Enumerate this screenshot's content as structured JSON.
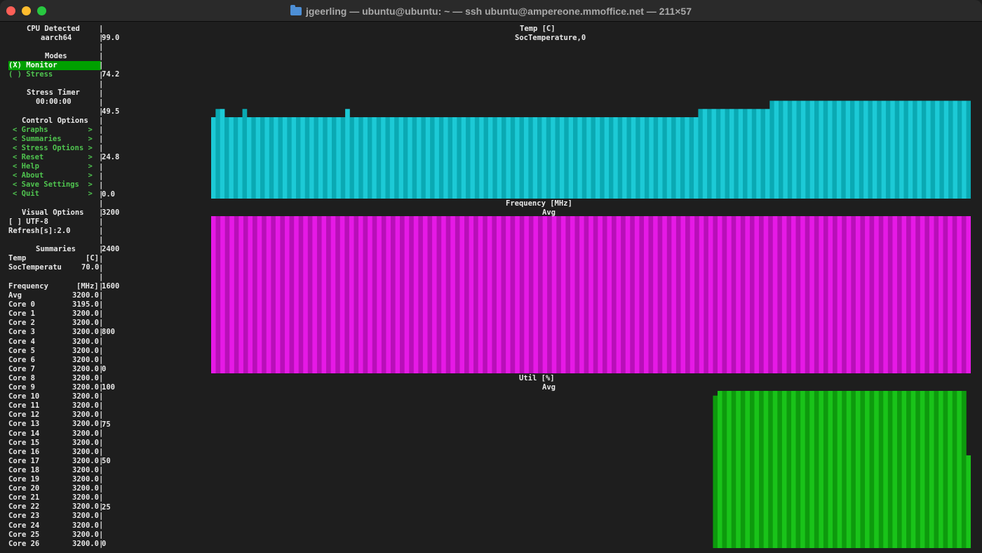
{
  "window": {
    "title": "jgeerling — ubuntu@ubuntu: ~ — ssh ubuntu@ampereone.mmoffice.net — 211×57"
  },
  "sidebar": {
    "cpu_header": "CPU Detected",
    "cpu_value": "aarch64",
    "modes_header": "Modes",
    "modes": [
      {
        "label": "(X) Monitor",
        "selected": true
      },
      {
        "label": "( ) Stress",
        "selected": false
      }
    ],
    "stress_timer_header": "Stress Timer",
    "stress_timer_value": "00:00:00",
    "control_header": "Control Options",
    "control_items": [
      "< Graphs         >",
      "< Summaries      >",
      "< Stress Options >",
      "< Reset          >",
      "< Help           >",
      "< About          >",
      "< Save Settings  >",
      "< Quit           >"
    ],
    "visual_header": "Visual Options",
    "utf8_option": "[ ] UTF-8",
    "refresh_option": "Refresh[s]:2.0",
    "summaries_header": "Summaries",
    "temp_row": {
      "label": "Temp",
      "unit": "[C]"
    },
    "soc_row": {
      "label": "SocTemperatu",
      "value": "70.0"
    },
    "freq_row": {
      "label": "Frequency",
      "unit": "[MHz]"
    },
    "freq_values": [
      {
        "label": "Avg",
        "value": "3200.0"
      },
      {
        "label": "Core 0",
        "value": "3195.0"
      },
      {
        "label": "Core 1",
        "value": "3200.0"
      },
      {
        "label": "Core 2",
        "value": "3200.0"
      },
      {
        "label": "Core 3",
        "value": "3200.0"
      },
      {
        "label": "Core 4",
        "value": "3200.0"
      },
      {
        "label": "Core 5",
        "value": "3200.0"
      },
      {
        "label": "Core 6",
        "value": "3200.0"
      },
      {
        "label": "Core 7",
        "value": "3200.0"
      },
      {
        "label": "Core 8",
        "value": "3200.0"
      },
      {
        "label": "Core 9",
        "value": "3200.0"
      },
      {
        "label": "Core 10",
        "value": "3200.0"
      },
      {
        "label": "Core 11",
        "value": "3200.0"
      },
      {
        "label": "Core 12",
        "value": "3200.0"
      },
      {
        "label": "Core 13",
        "value": "3200.0"
      },
      {
        "label": "Core 14",
        "value": "3200.0"
      },
      {
        "label": "Core 15",
        "value": "3200.0"
      },
      {
        "label": "Core 16",
        "value": "3200.0"
      },
      {
        "label": "Core 17",
        "value": "3200.0"
      },
      {
        "label": "Core 18",
        "value": "3200.0"
      },
      {
        "label": "Core 19",
        "value": "3200.0"
      },
      {
        "label": "Core 20",
        "value": "3200.0"
      },
      {
        "label": "Core 21",
        "value": "3200.0"
      },
      {
        "label": "Core 22",
        "value": "3200.0"
      },
      {
        "label": "Core 23",
        "value": "3200.0"
      },
      {
        "label": "Core 24",
        "value": "3200.0"
      },
      {
        "label": "Core 25",
        "value": "3200.0"
      },
      {
        "label": "Core 26",
        "value": "3200.0"
      }
    ]
  },
  "colors": {
    "temp": "#1ccad6",
    "temp_alt": "#0aa9b3",
    "freq": "#e619e6",
    "freq_alt": "#b80fb8",
    "util": "#19c319",
    "util_alt": "#0d9a0d"
  },
  "chart_data": [
    {
      "type": "bar",
      "title": "Temp [C]",
      "subtitle": "SocTemperature,0",
      "yticks": [
        "99.0",
        "74.2",
        "49.5",
        "24.8",
        "0.0"
      ],
      "ylim": [
        0,
        99.0
      ],
      "bar_values": [
        49.5,
        54.5,
        54.5,
        49.5,
        49.5,
        49.5,
        49.5,
        54.5,
        49.5,
        49.5,
        49.5,
        49.5,
        49.5,
        49.5,
        49.5,
        49.5,
        49.5,
        49.5,
        49.5,
        49.5,
        49.5,
        49.5,
        49.5,
        49.5,
        49.5,
        49.5,
        49.5,
        49.5,
        49.5,
        49.5,
        54.5,
        49.5,
        49.5,
        49.5,
        49.5,
        49.5,
        49.5,
        49.5,
        49.5,
        49.5,
        49.5,
        49.5,
        49.5,
        49.5,
        49.5,
        49.5,
        49.5,
        49.5,
        49.5,
        49.5,
        49.5,
        49.5,
        49.5,
        49.5,
        49.5,
        49.5,
        49.5,
        49.5,
        49.5,
        49.5,
        49.5,
        49.5,
        49.5,
        49.5,
        49.5,
        49.5,
        49.5,
        49.5,
        49.5,
        49.5,
        49.5,
        49.5,
        49.5,
        49.5,
        49.5,
        49.5,
        49.5,
        49.5,
        49.5,
        49.5,
        49.5,
        49.5,
        49.5,
        49.5,
        49.5,
        49.5,
        49.5,
        49.5,
        49.5,
        49.5,
        49.5,
        49.5,
        49.5,
        49.5,
        49.5,
        49.5,
        49.5,
        49.5,
        49.5,
        49.5,
        49.5,
        49.5,
        49.5,
        49.5,
        49.5,
        49.5,
        49.5,
        49.5,
        49.5,
        54.5,
        54.5,
        54.5,
        54.5,
        54.5,
        54.5,
        54.5,
        54.5,
        54.5,
        54.5,
        54.5,
        54.5,
        54.5,
        54.5,
        54.5,
        54.5,
        59.5,
        59.5,
        59.5,
        59.5,
        59.5,
        59.5,
        59.5,
        59.5,
        59.5,
        59.5,
        59.5,
        59.5,
        59.5,
        59.5,
        59.5,
        59.5,
        59.5,
        59.5,
        59.5,
        59.5,
        59.5,
        59.5,
        59.5,
        59.5,
        59.5,
        59.5,
        59.5,
        59.5,
        59.5,
        59.5,
        59.5,
        59.5,
        59.5,
        59.5,
        59.5,
        59.5,
        59.5,
        59.5,
        59.5,
        59.5,
        59.5,
        59.5,
        59.5,
        59.5,
        59.5
      ]
    },
    {
      "type": "bar",
      "title": "Frequency [MHz]",
      "subtitle": "Avg",
      "yticks": [
        "3200",
        "2400",
        "1600",
        "800",
        "0"
      ],
      "ylim": [
        0,
        3200
      ],
      "bar_values": [
        3200,
        3200,
        3200,
        3200,
        3200,
        3200,
        3200,
        3200,
        3200,
        3200,
        3200,
        3200,
        3200,
        3200,
        3200,
        3200,
        3200,
        3200,
        3200,
        3200,
        3200,
        3200,
        3200,
        3200,
        3200,
        3200,
        3200,
        3200,
        3200,
        3200,
        3200,
        3200,
        3200,
        3200,
        3200,
        3200,
        3200,
        3200,
        3200,
        3200,
        3200,
        3200,
        3200,
        3200,
        3200,
        3200,
        3200,
        3200,
        3200,
        3200,
        3200,
        3200,
        3200,
        3200,
        3200,
        3200,
        3200,
        3200,
        3200,
        3200,
        3200,
        3200,
        3200,
        3200,
        3200,
        3200,
        3200,
        3200,
        3200,
        3200,
        3200,
        3200,
        3200,
        3200,
        3200,
        3200,
        3200,
        3200,
        3200,
        3200,
        3200,
        3200,
        3200,
        3200,
        3200,
        3200,
        3200,
        3200,
        3200,
        3200,
        3200,
        3200,
        3200,
        3200,
        3200,
        3200,
        3200,
        3200,
        3200,
        3200,
        3200,
        3200,
        3200,
        3200,
        3200,
        3200,
        3200,
        3200,
        3200,
        3200,
        3200,
        3200,
        3200,
        3200,
        3200,
        3200,
        3200,
        3200,
        3200,
        3200,
        3200,
        3200,
        3200,
        3200,
        3200,
        3200,
        3200,
        3200,
        3200,
        3200,
        3200,
        3200,
        3200,
        3200,
        3200,
        3200,
        3200,
        3200,
        3200,
        3200,
        3200,
        3200,
        3200,
        3200,
        3200,
        3200,
        3200,
        3200,
        3200,
        3200,
        3200,
        3200,
        3200,
        3200,
        3200,
        3200,
        3200,
        3200,
        3200,
        3200,
        3200,
        3200,
        3200,
        3200,
        3200
      ]
    },
    {
      "type": "bar",
      "title": "Util [%]",
      "subtitle": "Avg",
      "yticks": [
        "100",
        "75",
        "50",
        "25",
        "0"
      ],
      "ylim": [
        0,
        100
      ],
      "bar_values": [
        0,
        0,
        0,
        0,
        0,
        0,
        0,
        0,
        0,
        0,
        0,
        0,
        0,
        0,
        0,
        0,
        0,
        0,
        0,
        0,
        0,
        0,
        0,
        0,
        0,
        0,
        0,
        0,
        0,
        0,
        0,
        0,
        0,
        0,
        0,
        0,
        0,
        0,
        0,
        0,
        0,
        0,
        0,
        0,
        0,
        0,
        0,
        0,
        0,
        0,
        0,
        0,
        0,
        0,
        0,
        0,
        0,
        0,
        0,
        0,
        0,
        0,
        0,
        0,
        0,
        0,
        0,
        0,
        0,
        0,
        0,
        0,
        0,
        0,
        0,
        0,
        0,
        0,
        0,
        0,
        0,
        0,
        0,
        0,
        0,
        0,
        0,
        0,
        0,
        0,
        0,
        0,
        0,
        0,
        0,
        0,
        0,
        0,
        0,
        0,
        0,
        0,
        0,
        0,
        0,
        0,
        0,
        0,
        0,
        97,
        100,
        100,
        100,
        100,
        100,
        100,
        100,
        100,
        100,
        100,
        100,
        100,
        100,
        100,
        100,
        100,
        100,
        100,
        100,
        100,
        100,
        100,
        100,
        100,
        100,
        100,
        100,
        100,
        100,
        100,
        100,
        100,
        100,
        100,
        100,
        100,
        100,
        100,
        100,
        100,
        100,
        100,
        100,
        100,
        100,
        100,
        100,
        100,
        100,
        100,
        100,
        100,
        100,
        100,
        59
      ]
    }
  ]
}
